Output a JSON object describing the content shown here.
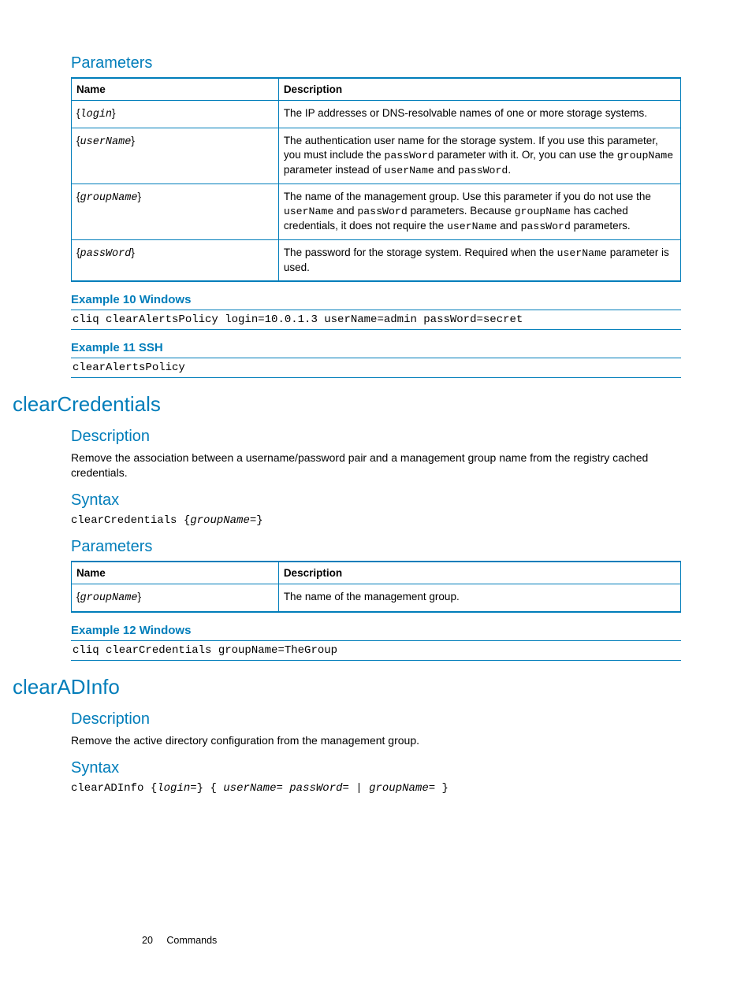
{
  "section_parameters1": {
    "title": "Parameters",
    "table": {
      "headers": [
        "Name",
        "Description"
      ],
      "rows": [
        {
          "name_pre": "{",
          "name_code": "login",
          "name_post": "}",
          "desc_parts": [
            {
              "t": "text",
              "v": "The IP addresses or DNS-resolvable names of one or more storage systems."
            }
          ]
        },
        {
          "name_pre": "{",
          "name_code": "userName",
          "name_post": "}",
          "desc_parts": [
            {
              "t": "text",
              "v": "The authentication user name for the storage system. If you use this parameter, you must include the "
            },
            {
              "t": "mono",
              "v": "passWord"
            },
            {
              "t": "text",
              "v": " parameter with it. Or, you can use the "
            },
            {
              "t": "mono",
              "v": "groupName"
            },
            {
              "t": "text",
              "v": " parameter instead of "
            },
            {
              "t": "mono",
              "v": "userName"
            },
            {
              "t": "text",
              "v": " and "
            },
            {
              "t": "mono",
              "v": "passWord"
            },
            {
              "t": "text",
              "v": "."
            }
          ]
        },
        {
          "name_pre": "{",
          "name_code": "groupName",
          "name_post": "}",
          "desc_parts": [
            {
              "t": "text",
              "v": "The name of the management group. Use this parameter if you do not use the "
            },
            {
              "t": "mono",
              "v": "userName"
            },
            {
              "t": "text",
              "v": " and "
            },
            {
              "t": "mono",
              "v": "passWord"
            },
            {
              "t": "text",
              "v": " parameters. Because "
            },
            {
              "t": "mono",
              "v": "groupName"
            },
            {
              "t": "text",
              "v": " has cached credentials, it does not require the "
            },
            {
              "t": "mono",
              "v": "userName"
            },
            {
              "t": "text",
              "v": " and "
            },
            {
              "t": "mono",
              "v": "passWord"
            },
            {
              "t": "text",
              "v": " parameters."
            }
          ]
        },
        {
          "name_pre": "{",
          "name_code": "passWord",
          "name_post": "}",
          "desc_parts": [
            {
              "t": "text",
              "v": "The password for the storage system. Required when the "
            },
            {
              "t": "mono",
              "v": "userName"
            },
            {
              "t": "text",
              "v": " parameter is used."
            }
          ]
        }
      ]
    }
  },
  "example10": {
    "title": "Example 10 Windows",
    "code": "cliq clearAlertsPolicy login=10.0.1.3 userName=admin passWord=secret"
  },
  "example11": {
    "title": "Example 11 SSH",
    "code": "clearAlertsPolicy"
  },
  "clearCredentials": {
    "heading": "clearCredentials",
    "description_title": "Description",
    "description_body": "Remove the association between a username/password pair and a management group name from the registry cached credentials.",
    "syntax_title": "Syntax",
    "syntax_parts": [
      {
        "t": "mono",
        "v": "clearCredentials "
      },
      {
        "t": "text",
        "v": "{"
      },
      {
        "t": "mono-ital",
        "v": "groupName="
      },
      {
        "t": "text",
        "v": "}"
      }
    ],
    "parameters_title": "Parameters",
    "table": {
      "headers": [
        "Name",
        "Description"
      ],
      "rows": [
        {
          "name_pre": "{",
          "name_code": "groupName",
          "name_post": "}",
          "desc_parts": [
            {
              "t": "text",
              "v": "The name of the management group."
            }
          ]
        }
      ]
    }
  },
  "example12": {
    "title": "Example 12 Windows",
    "code": "cliq clearCredentials groupName=TheGroup"
  },
  "clearADInfo": {
    "heading": "clearADInfo",
    "description_title": "Description",
    "description_body": "Remove the active directory configuration from the management group.",
    "syntax_title": "Syntax",
    "syntax_parts": [
      {
        "t": "mono",
        "v": "clearADInfo "
      },
      {
        "t": "text",
        "v": "{"
      },
      {
        "t": "mono-ital",
        "v": "login="
      },
      {
        "t": "text",
        "v": "} { "
      },
      {
        "t": "mono-ital",
        "v": "userName= passWord= "
      },
      {
        "t": "text",
        "v": "|"
      },
      {
        "t": "mono-ital",
        "v": " groupName= "
      },
      {
        "t": "text",
        "v": "}"
      }
    ]
  },
  "footer": {
    "page": "20",
    "section": "Commands"
  }
}
